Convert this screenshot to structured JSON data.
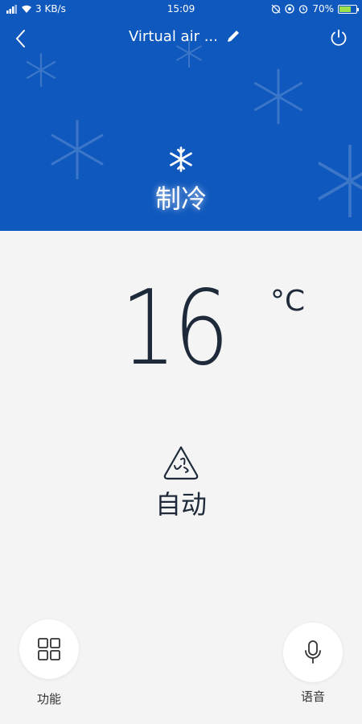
{
  "status_bar": {
    "network_speed": "3 KB/s",
    "time": "15:09",
    "battery": "70%",
    "battery_level": 0.7
  },
  "header": {
    "title": "Virtual air ...",
    "back_icon": "chevron-left-icon",
    "edit_icon": "pencil-icon",
    "power_icon": "power-icon"
  },
  "mode": {
    "icon": "snowflake-icon",
    "label": "制冷"
  },
  "temperature": {
    "value": "16",
    "unit": "°C"
  },
  "fan": {
    "icon": "fan-icon",
    "label": "自动"
  },
  "bottom": {
    "functions_label": "功能",
    "voice_label": "语音"
  },
  "colors": {
    "header_bg": "#0f58bd",
    "body_bg": "#f4f4f4",
    "text_dark": "#1e2a3a"
  }
}
